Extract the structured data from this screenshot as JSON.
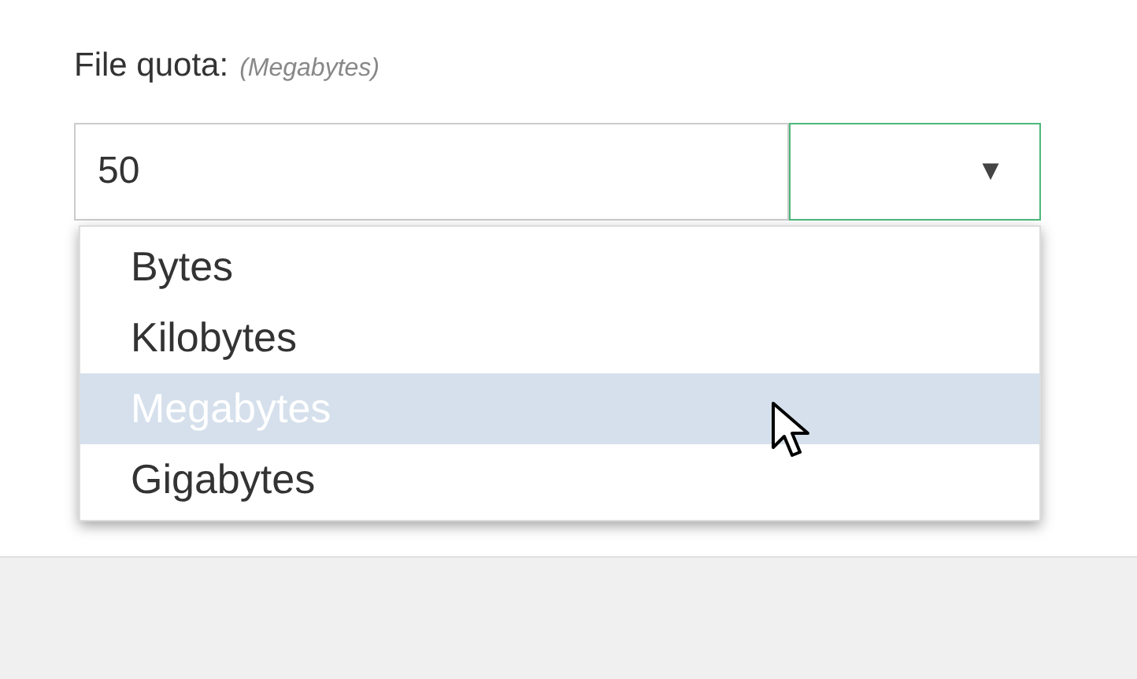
{
  "label": "File quota:",
  "unit_hint": "(Megabytes)",
  "quota_field": {
    "value": "50"
  },
  "unit_select": {
    "caret": "▼",
    "expanded": true,
    "options": [
      {
        "label": "Bytes",
        "selected": false
      },
      {
        "label": "Kilobytes",
        "selected": false
      },
      {
        "label": "Megabytes",
        "selected": true
      },
      {
        "label": "Gigabytes",
        "selected": false
      }
    ]
  }
}
